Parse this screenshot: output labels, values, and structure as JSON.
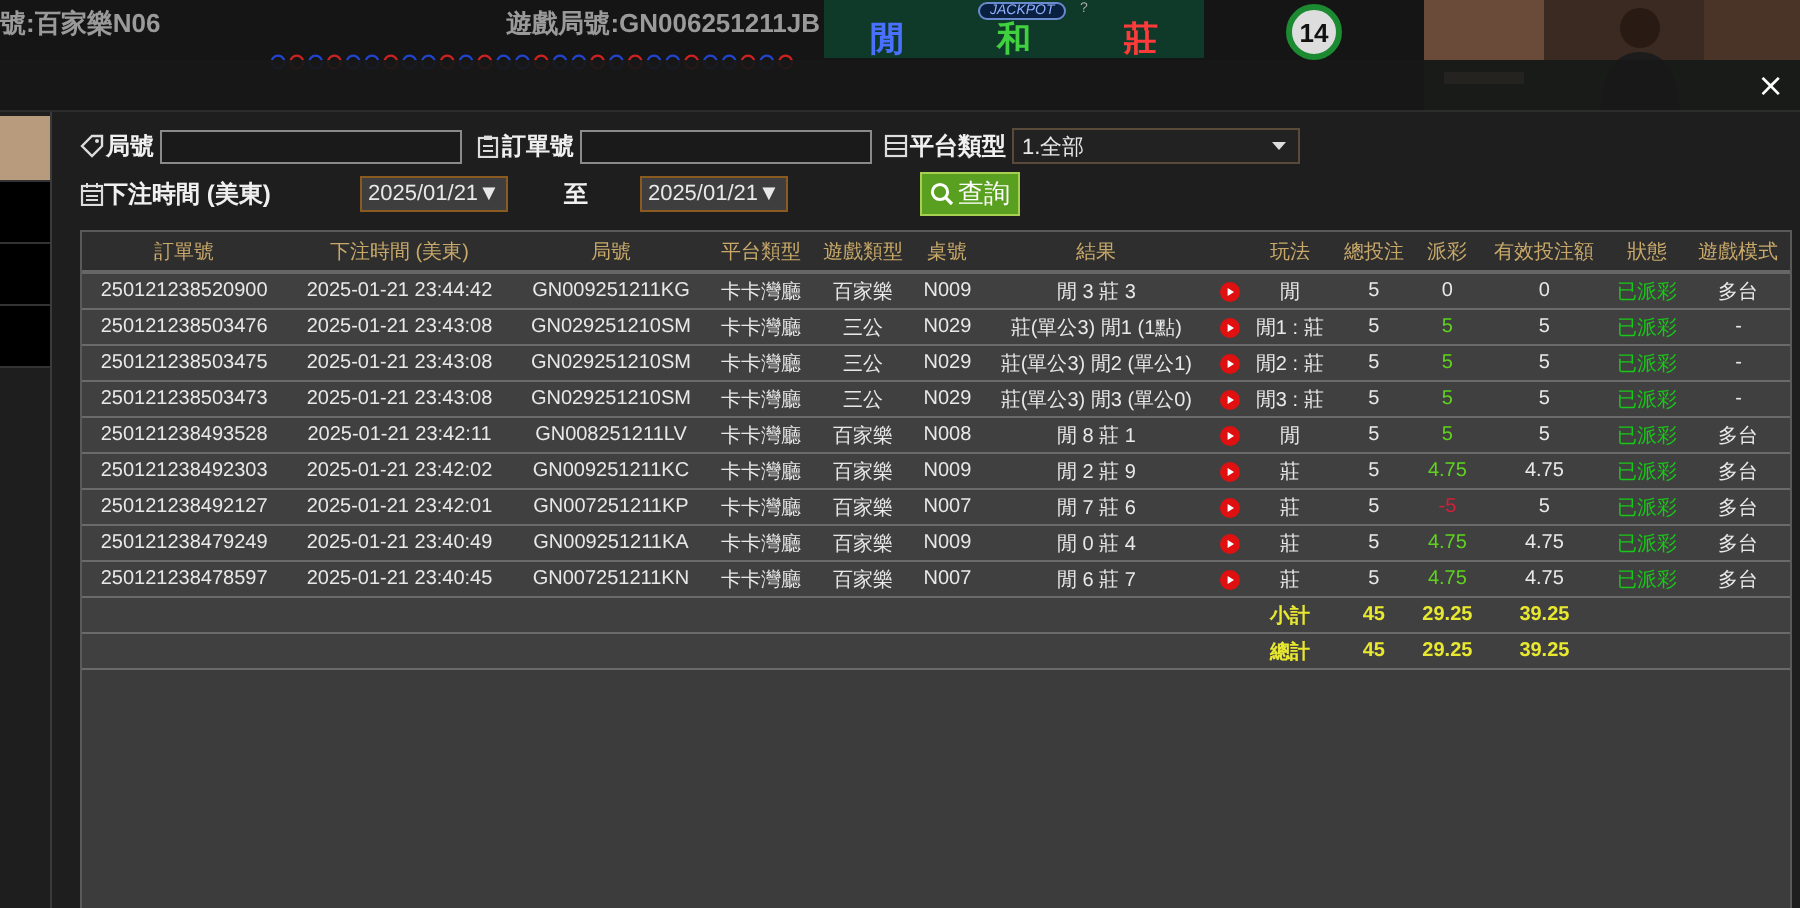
{
  "game_header": {
    "table_name": "號:百家樂N06",
    "round_id": "遊戲局號:GN006251211JB",
    "bets": [
      "閒",
      "和",
      "莊"
    ],
    "jackpot": "JACKPOT",
    "jackpot_help": "?",
    "countdown": "14"
  },
  "dialog": {
    "close": "×"
  },
  "sidebar": [
    {
      "selected": true
    },
    {
      "selected": false
    },
    {
      "selected": false
    },
    {
      "selected": false
    }
  ],
  "filters": {
    "round_label": "局號",
    "order_label": "訂單號",
    "platform_label": "平台類型",
    "platform_value": "1.全部",
    "time_label": "下注時間 (美東)",
    "date_from": "2025/01/21▼",
    "to_label": "至",
    "date_to": "2025/01/21▼",
    "search_button": "查詢"
  },
  "table": {
    "columns": [
      "訂單號",
      "下注時間 (美東)",
      "局號",
      "平台類型",
      "遊戲類型",
      "桌號",
      "結果",
      "",
      "玩法",
      "總投注",
      "派彩",
      "有效投注額",
      "狀態",
      "遊戲模式"
    ],
    "rows": [
      {
        "order": "250121238520900",
        "time": "2025-01-21 23:44:42",
        "round": "GN009251211KG",
        "platform": "卡卡灣廳",
        "game": "百家樂",
        "table": "N009",
        "result": "閒 3 莊 3",
        "play": "閒",
        "bet": "5",
        "payout": "0",
        "color": "#e8e8e8",
        "valid": "0",
        "status": "已派彩",
        "mode": "多台"
      },
      {
        "order": "250121238503476",
        "time": "2025-01-21 23:43:08",
        "round": "GN029251210SM",
        "platform": "卡卡灣廳",
        "game": "三公",
        "table": "N029",
        "result": "莊(單公3) 閒1 (1點)",
        "play": "閒1 : 莊",
        "bet": "5",
        "payout": "5",
        "color": "#5fd21e",
        "valid": "5",
        "status": "已派彩",
        "mode": "-"
      },
      {
        "order": "250121238503475",
        "time": "2025-01-21 23:43:08",
        "round": "GN029251210SM",
        "platform": "卡卡灣廳",
        "game": "三公",
        "table": "N029",
        "result": "莊(單公3) 閒2 (單公1)",
        "play": "閒2 : 莊",
        "bet": "5",
        "payout": "5",
        "color": "#5fd21e",
        "valid": "5",
        "status": "已派彩",
        "mode": "-"
      },
      {
        "order": "250121238503473",
        "time": "2025-01-21 23:43:08",
        "round": "GN029251210SM",
        "platform": "卡卡灣廳",
        "game": "三公",
        "table": "N029",
        "result": "莊(單公3) 閒3 (單公0)",
        "play": "閒3 : 莊",
        "bet": "5",
        "payout": "5",
        "color": "#5fd21e",
        "valid": "5",
        "status": "已派彩",
        "mode": "-"
      },
      {
        "order": "250121238493528",
        "time": "2025-01-21 23:42:11",
        "round": "GN008251211LV",
        "platform": "卡卡灣廳",
        "game": "百家樂",
        "table": "N008",
        "result": "閒 8 莊 1",
        "play": "閒",
        "bet": "5",
        "payout": "5",
        "color": "#5fd21e",
        "valid": "5",
        "status": "已派彩",
        "mode": "多台"
      },
      {
        "order": "250121238492303",
        "time": "2025-01-21 23:42:02",
        "round": "GN009251211KC",
        "platform": "卡卡灣廳",
        "game": "百家樂",
        "table": "N009",
        "result": "閒 2 莊 9",
        "play": "莊",
        "bet": "5",
        "payout": "4.75",
        "color": "#5fd21e",
        "valid": "4.75",
        "status": "已派彩",
        "mode": "多台"
      },
      {
        "order": "250121238492127",
        "time": "2025-01-21 23:42:01",
        "round": "GN007251211KP",
        "platform": "卡卡灣廳",
        "game": "百家樂",
        "table": "N007",
        "result": "閒 7 莊 6",
        "play": "莊",
        "bet": "5",
        "payout": "-5",
        "color": "#d0203a",
        "valid": "5",
        "status": "已派彩",
        "mode": "多台"
      },
      {
        "order": "250121238479249",
        "time": "2025-01-21 23:40:49",
        "round": "GN009251211KA",
        "platform": "卡卡灣廳",
        "game": "百家樂",
        "table": "N009",
        "result": "閒 0 莊 4",
        "play": "莊",
        "bet": "5",
        "payout": "4.75",
        "color": "#5fd21e",
        "valid": "4.75",
        "status": "已派彩",
        "mode": "多台"
      },
      {
        "order": "250121238478597",
        "time": "2025-01-21 23:40:45",
        "round": "GN007251211KN",
        "platform": "卡卡灣廳",
        "game": "百家樂",
        "table": "N007",
        "result": "閒 6 莊 7",
        "play": "莊",
        "bet": "5",
        "payout": "4.75",
        "color": "#5fd21e",
        "valid": "4.75",
        "status": "已派彩",
        "mode": "多台"
      }
    ],
    "totals": [
      {
        "label": "小計",
        "bet": "45",
        "payout": "29.25",
        "valid": "39.25"
      },
      {
        "label": "總計",
        "bet": "45",
        "payout": "29.25",
        "valid": "39.25"
      }
    ]
  }
}
